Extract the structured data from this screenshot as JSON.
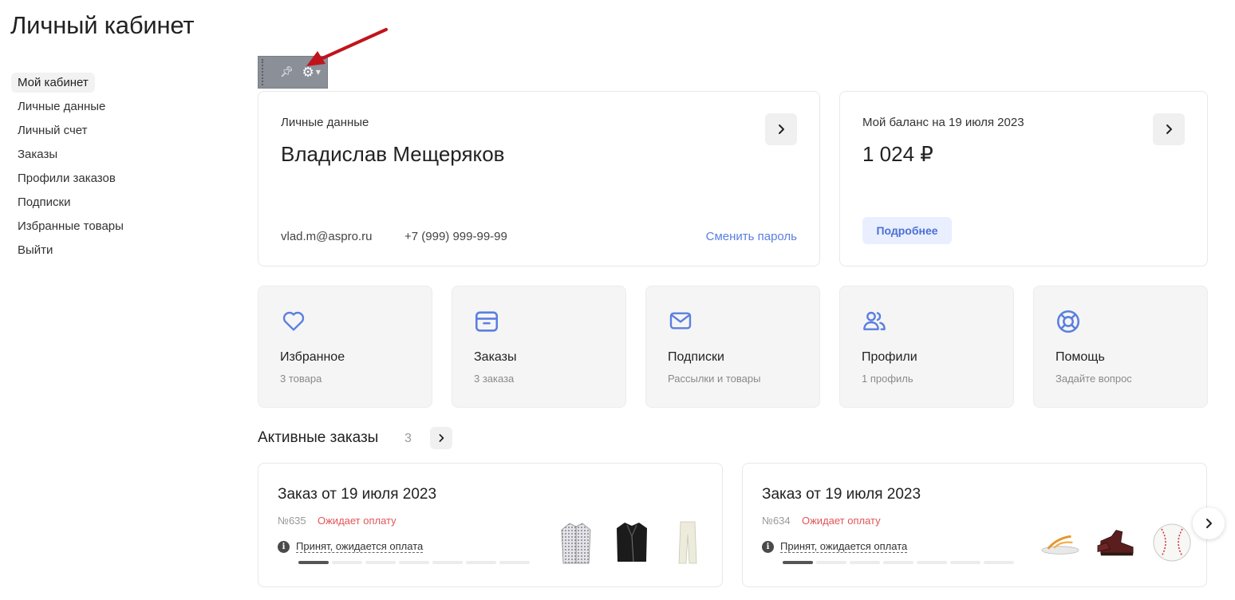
{
  "page": {
    "title": "Личный кабинет"
  },
  "sidebar": {
    "items": [
      {
        "label": "Мой кабинет",
        "active": true
      },
      {
        "label": "Личные данные"
      },
      {
        "label": "Личный счет"
      },
      {
        "label": "Заказы"
      },
      {
        "label": "Профили заказов"
      },
      {
        "label": "Подписки"
      },
      {
        "label": "Избранные товары"
      },
      {
        "label": "Выйти"
      }
    ]
  },
  "toolbar": {
    "icons": [
      "grip-icon",
      "pin-icon",
      "gear-icon",
      "caret-down-icon"
    ]
  },
  "personal": {
    "label": "Личные данные",
    "name": "Владислав Мещеряков",
    "email": "vlad.m@aspro.ru",
    "phone": "+7 (999) 999-99-99",
    "change_password": "Сменить пароль"
  },
  "balance": {
    "label": "Мой баланс на 19 июля 2023",
    "amount": "1 024 ₽",
    "more": "Подробнее"
  },
  "tiles": [
    {
      "title": "Избранное",
      "sub": "3 товара",
      "icon": "heart-icon"
    },
    {
      "title": "Заказы",
      "sub": "3 заказа",
      "icon": "box-icon"
    },
    {
      "title": "Подписки",
      "sub": "Рассылки и товары",
      "icon": "mail-icon"
    },
    {
      "title": "Профили",
      "sub": "1 профиль",
      "icon": "users-icon"
    },
    {
      "title": "Помощь",
      "sub": "Задайте вопрос",
      "icon": "lifebuoy-icon"
    }
  ],
  "active_orders": {
    "title": "Активные заказы",
    "count": "3",
    "orders": [
      {
        "title": "Заказ от 19 июля 2023",
        "number": "№635",
        "status": "Ожидает оплату",
        "info": "Принят, ожидается оплата",
        "progress_done": 1,
        "progress_total": 7,
        "items": [
          "shirt",
          "leather-jacket",
          "trousers"
        ]
      },
      {
        "title": "Заказ от 19 июля 2023",
        "number": "№634",
        "status": "Ожидает оплату",
        "info": "Принят, ожидается оплата",
        "progress_done": 1,
        "progress_total": 7,
        "items": [
          "flip-flops",
          "boots",
          "baseball"
        ]
      }
    ]
  },
  "colors": {
    "accent": "#5b7fe0",
    "status": "#e0555a",
    "annotation_arrow": "#c0141c"
  }
}
